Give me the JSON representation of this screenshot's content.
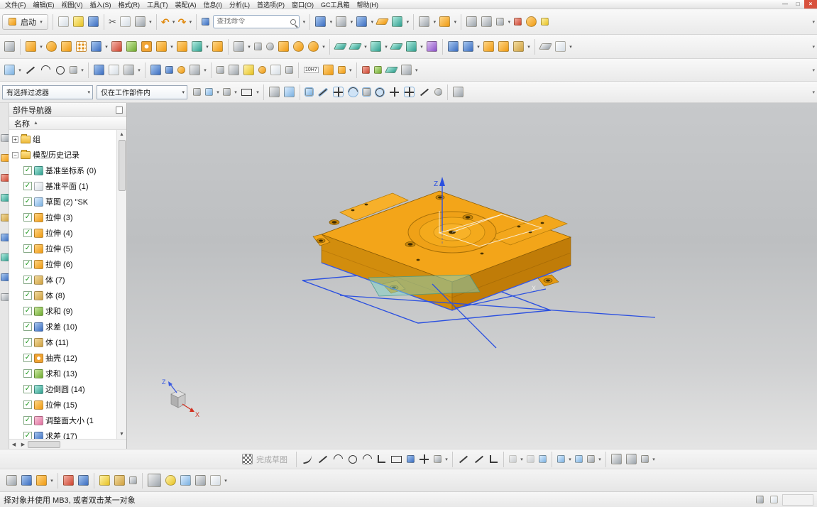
{
  "icons": {
    "dd": "▾",
    "check": "✓",
    "plus": "+",
    "minus": "−",
    "undo": "↶",
    "redo": "↷",
    "scissors": "✂",
    "up": "▲",
    "down": "▼",
    "left": "◀",
    "right": "▶",
    "sort": "▲",
    "min": "—",
    "max": "□",
    "close": "×"
  },
  "menu": {
    "items": [
      "文件(F)",
      "编辑(E)",
      "视图(V)",
      "插入(S)",
      "格式(R)",
      "工具(T)",
      "装配(A)",
      "信息(I)",
      "分析(L)",
      "首选项(P)",
      "窗口(O)",
      "GC工具箱",
      "帮助(H)"
    ]
  },
  "toolbar1": {
    "start": "启动",
    "search_placeholder": "查找命令"
  },
  "toolbar3": {
    "tolerance": "10H7"
  },
  "filterbar": {
    "filter": "有选择过滤器",
    "scope": "仅在工作部件内"
  },
  "navigator": {
    "title": "部件导航器",
    "name_header": "名称",
    "items": [
      {
        "label": "组"
      },
      {
        "label": "模型历史记录"
      },
      {
        "label": "基准坐标系 (0)"
      },
      {
        "label": "基准平面 (1)"
      },
      {
        "label": "草图 (2) \"SK"
      },
      {
        "label": "拉伸 (3)"
      },
      {
        "label": "拉伸 (4)"
      },
      {
        "label": "拉伸 (5)"
      },
      {
        "label": "拉伸 (6)"
      },
      {
        "label": "体 (7)"
      },
      {
        "label": "体 (8)"
      },
      {
        "label": "求和 (9)"
      },
      {
        "label": "求差 (10)"
      },
      {
        "label": "体 (11)"
      },
      {
        "label": "抽壳 (12)"
      },
      {
        "label": "求和 (13)"
      },
      {
        "label": "边倒圆 (14)"
      },
      {
        "label": "拉伸 (15)"
      },
      {
        "label": "调整面大小 (1"
      },
      {
        "label": "求差 (17)"
      }
    ]
  },
  "viewport": {
    "z_label": "Z",
    "sketch_x_label": "X",
    "triad_z": "Z",
    "triad_x": "X"
  },
  "sketchbar": {
    "finish": "完成草图"
  },
  "statusbar": {
    "message": "择对象并使用 MB3, 或者双击某一对象"
  }
}
